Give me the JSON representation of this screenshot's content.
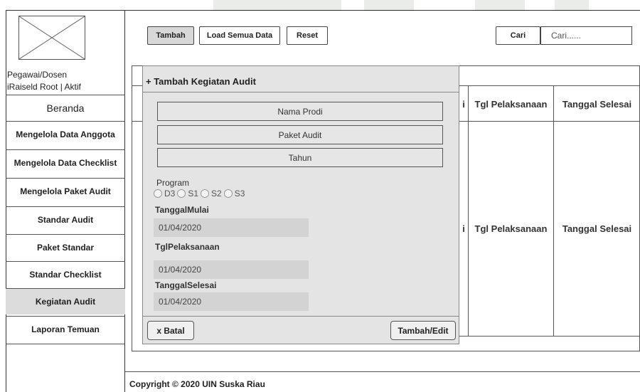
{
  "sidebar": {
    "user_role": "Pegawai/Dosen",
    "user_status": "iRaiseld Root  |  Aktif",
    "items": [
      {
        "label": "Beranda"
      },
      {
        "label": "Mengelola Data Anggota"
      },
      {
        "label": "Mengelola Data Checklist"
      },
      {
        "label": "Mengelola Paket Audit"
      },
      {
        "label": "Standar Audit"
      },
      {
        "label": "Paket Standar"
      },
      {
        "label": "Standar Checklist"
      },
      {
        "label": "Kegiatan Audit",
        "active": true
      },
      {
        "label": "Laporan Temuan"
      }
    ]
  },
  "toolbar": {
    "add_label": "Tambah",
    "load_all_label": "Load Semua Data",
    "reset_label": "Reset",
    "search_button_label": "Cari",
    "search_placeholder": "Cari......"
  },
  "table": {
    "partial_col_char": "i",
    "columns": [
      "Tgl Pelaksanaan",
      "Tanggal Selesai"
    ],
    "row_values": [
      "Tgl Pelaksanaan",
      "Tanggal Selesai"
    ]
  },
  "modal": {
    "title": "+ Tambah Kegiatan Audit",
    "prodi_label": "Nama Prodi",
    "paket_label": "Paket Audit",
    "tahun_label": "Tahun",
    "program_label": "Program",
    "program_options": [
      "D3",
      "S1",
      "S2",
      "S3"
    ],
    "tanggal_mulai_label": "TanggalMulai",
    "tanggal_mulai_value": "01/04/2020",
    "tgl_pelaksanaan_label": "TglPelaksanaan",
    "tgl_pelaksanaan_value": "01/04/2020",
    "tanggal_selesai_label": "TanggalSelesai",
    "tanggal_selesai_value": "01/04/2020",
    "cancel_label": "x Batal",
    "submit_label": "Tambah/Edit"
  },
  "footer": {
    "copyright": "Copyright © 2020 UIN Suska Riau"
  },
  "colors": {
    "active_menu": "#dcdcdc",
    "modal_bg": "#e4e4e4",
    "date_field_bg": "#d3d3d3"
  }
}
